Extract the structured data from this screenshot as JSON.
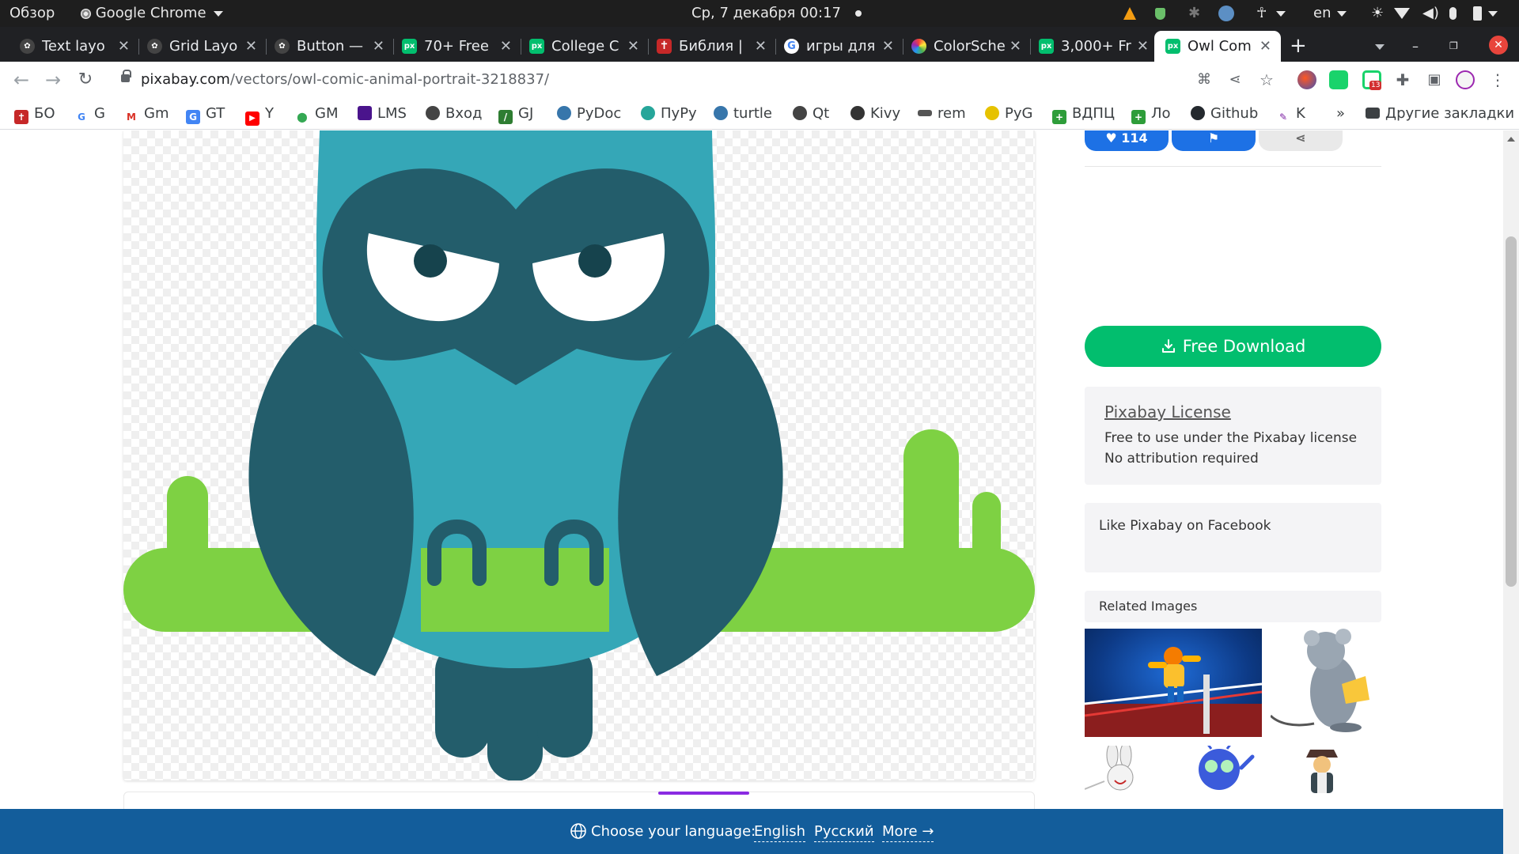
{
  "os_bar": {
    "overview": "Обзор",
    "app_name": "Google Chrome",
    "datetime": "Ср, 7 декабря  00:17",
    "keyboard_layout": "en"
  },
  "tabs": [
    {
      "title": "Text layo",
      "favicon": "gnome-icon",
      "active": false
    },
    {
      "title": "Grid Layo",
      "favicon": "gnome-icon",
      "active": false
    },
    {
      "title": "Button —",
      "favicon": "gnome-icon",
      "active": false
    },
    {
      "title": "70+ Free",
      "favicon": "pixabay-icon",
      "active": false
    },
    {
      "title": "College C",
      "favicon": "pixabay-icon",
      "active": false
    },
    {
      "title": "Библия |",
      "favicon": "cross-icon",
      "active": false
    },
    {
      "title": "игры для",
      "favicon": "google-icon",
      "active": false
    },
    {
      "title": "ColorSche",
      "favicon": "colorwheel-icon",
      "active": false
    },
    {
      "title": "3,000+ Fr",
      "favicon": "pixabay-icon",
      "active": false
    },
    {
      "title": "Owl Com",
      "favicon": "pixabay-icon",
      "active": true
    }
  ],
  "new_tab_label": "+",
  "toolbar": {
    "url_host": "pixabay.com",
    "url_path": "/vectors/owl-comic-animal-portrait-3218837/",
    "extension_badge": "13"
  },
  "bookmarks": [
    {
      "label": "БО",
      "icon": "cross-icon",
      "color": "#c62828"
    },
    {
      "label": "G",
      "icon": "google-icon",
      "color": "#4285f4"
    },
    {
      "label": "Gm",
      "icon": "gmail-icon",
      "color": "#d93025"
    },
    {
      "label": "GT",
      "icon": "translate-icon",
      "color": "#4285f4"
    },
    {
      "label": "Y",
      "icon": "youtube-icon",
      "color": "#ff0000"
    },
    {
      "label": "GM",
      "icon": "maps-pin-icon",
      "color": "#34a853"
    },
    {
      "label": "LMS",
      "icon": "bookmark-icon",
      "color": "#4a148c"
    },
    {
      "label": "Вход",
      "icon": "globe-icon",
      "color": "#444444"
    },
    {
      "label": "GJ",
      "icon": "gj-icon",
      "color": "#2e7d32"
    },
    {
      "label": "PyDoc",
      "icon": "python-icon",
      "color": "#3776ab"
    },
    {
      "label": "ПуРу",
      "icon": "pypru-icon",
      "color": "#26a69a"
    },
    {
      "label": "turtle",
      "icon": "python-icon",
      "color": "#3776ab"
    },
    {
      "label": "Qt",
      "icon": "globe-icon",
      "color": "#444444"
    },
    {
      "label": "Kivy",
      "icon": "kivy-icon",
      "color": "#333333"
    },
    {
      "label": "rem",
      "icon": "rem-icon",
      "color": "#555555"
    },
    {
      "label": "PyG",
      "icon": "pygame-icon",
      "color": "#e6c200"
    },
    {
      "label": "ВДПЦ",
      "icon": "plus-icon",
      "color": "#2e9d3a"
    },
    {
      "label": "Ло",
      "icon": "plus-icon",
      "color": "#2e9d3a"
    },
    {
      "label": "Github",
      "icon": "github-icon",
      "color": "#24292e"
    },
    {
      "label": "K",
      "icon": "pen-icon",
      "color": "#7b1fa2"
    }
  ],
  "bookmarks_overflow": "»",
  "other_bookmarks": "Другие закладки",
  "page": {
    "like_count": "114",
    "download_label": "Free Download",
    "license_title": "Pixabay License",
    "license_line1": "Free to use under the Pixabay license",
    "license_line2": "No attribution required",
    "facebook_text": "Like Pixabay on Facebook",
    "related_title": "Related Images"
  },
  "language_bar": {
    "prompt": "Choose your language:",
    "english": "English",
    "russian": "Русский",
    "more": "More →"
  },
  "colors": {
    "owl_body": "#35a7b7",
    "owl_dark": "#235d6b",
    "branch_green": "#7ed143",
    "download_green": "#02be6e",
    "accent_blue": "#1d71e5",
    "language_bar": "#135d9b"
  }
}
